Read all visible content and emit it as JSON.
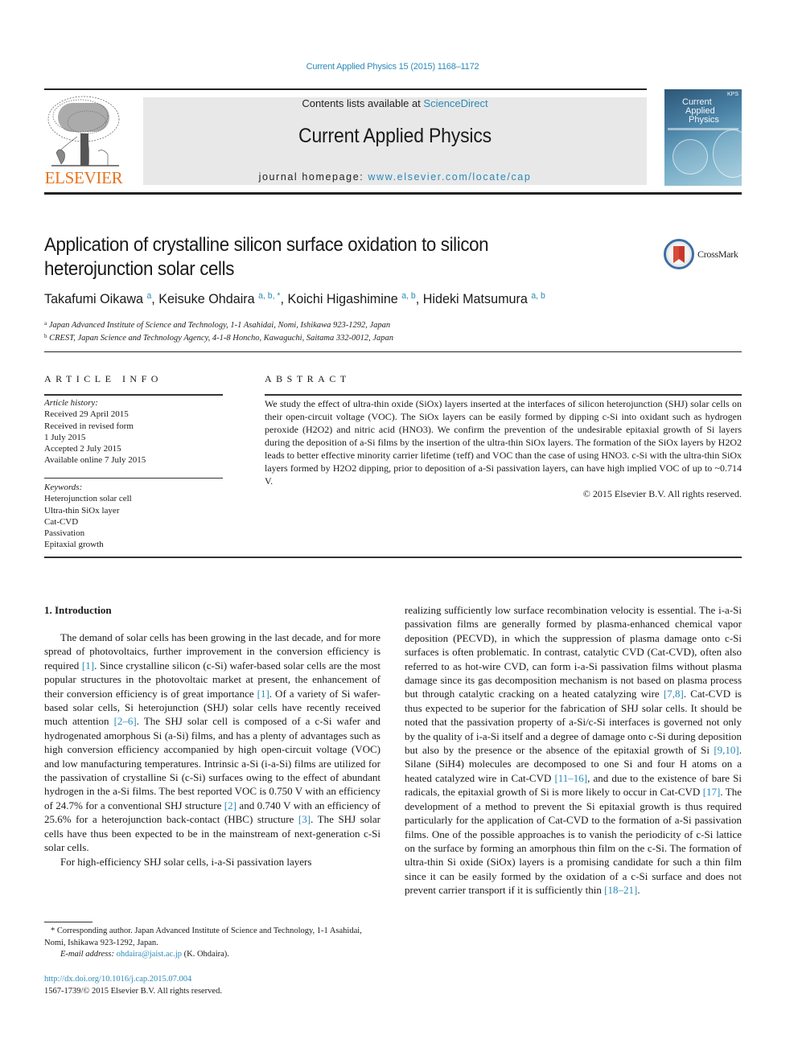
{
  "header": {
    "journal_ref": "Current Applied Physics 15 (2015) 1168–1172",
    "contents_prefix": "Contents lists available at ",
    "contents_link": "ScienceDirect",
    "journal_title": "Current Applied Physics",
    "homepage_prefix": "journal homepage: ",
    "homepage_link": "www.elsevier.com/locate/cap",
    "publisher_logo_text": "ELSEVIER",
    "cover": {
      "title_line1": "Current",
      "title_line2": "Applied",
      "title_line3": "Physics",
      "badge": "KPS"
    },
    "crossmark_label": "CrossMark",
    "colors": {
      "link": "#2a8ab8",
      "elsevier_orange": "#e7721f",
      "masthead_bg": "#e8e8e8"
    }
  },
  "article": {
    "title": "Application of crystalline silicon surface oxidation to silicon heterojunction solar cells",
    "authors": [
      {
        "name": "Takafumi Oikawa",
        "affil": "a",
        "sep": ", "
      },
      {
        "name": "Keisuke Ohdaira",
        "affil": "a, b, *",
        "sep": ", "
      },
      {
        "name": "Koichi Higashimine",
        "affil": "a, b",
        "sep": ", "
      },
      {
        "name": "Hideki Matsumura",
        "affil": "a, b",
        "sep": ""
      }
    ],
    "affiliations": [
      {
        "mark": "a",
        "text": "Japan Advanced Institute of Science and Technology, 1-1 Asahidai, Nomi, Ishikawa 923-1292, Japan"
      },
      {
        "mark": "b",
        "text": "CREST, Japan Science and Technology Agency, 4-1-8 Honcho, Kawaguchi, Saitama 332-0012, Japan"
      }
    ]
  },
  "article_info": {
    "heading": "ARTICLE INFO",
    "history_label": "Article history:",
    "history": [
      "Received 29 April 2015",
      "Received in revised form",
      "1 July 2015",
      "Accepted 2 July 2015",
      "Available online 7 July 2015"
    ],
    "keywords_label": "Keywords:",
    "keywords": [
      "Heterojunction solar cell",
      "Ultra-thin SiOx layer",
      "Cat-CVD",
      "Passivation",
      "Epitaxial growth"
    ]
  },
  "abstract": {
    "heading": "ABSTRACT",
    "text": "We study the effect of ultra-thin oxide (SiOx) layers inserted at the interfaces of silicon heterojunction (SHJ) solar cells on their open-circuit voltage (VOC). The SiOx layers can be easily formed by dipping c-Si into oxidant such as hydrogen peroxide (H2O2) and nitric acid (HNO3). We confirm the prevention of the undesirable epitaxial growth of Si layers during the deposition of a-Si films by the insertion of the ultra-thin SiOx layers. The formation of the SiOx layers by H2O2 leads to better effective minority carrier lifetime (τeff) and VOC than the case of using HNO3. c-Si with the ultra-thin SiOx layers formed by H2O2 dipping, prior to deposition of a-Si passivation layers, can have high implied VOC of up to ~0.714 V.",
    "copyright": "© 2015 Elsevier B.V. All rights reserved."
  },
  "body": {
    "section_heading": "1.  Introduction",
    "left_par1": "The demand of solar cells has been growing in the last decade, and for more spread of photovoltaics, further improvement in the conversion efficiency is required [1]. Since crystalline silicon (c-Si) wafer-based solar cells are the most popular structures in the photovoltaic market at present, the enhancement of their conversion efficiency is of great importance [1]. Of a variety of Si wafer-based solar cells, Si heterojunction (SHJ) solar cells have recently received much attention [2–6]. The SHJ solar cell is composed of a c-Si wafer and hydrogenated amorphous Si (a-Si) films, and has a plenty of advantages such as high conversion efficiency accompanied by high open-circuit voltage (VOC) and low manufacturing temperatures. Intrinsic a-Si (i-a-Si) films are utilized for the passivation of crystalline Si (c-Si) surfaces owing to the effect of abundant hydrogen in the a-Si films. The best reported VOC is 0.750 V with an efficiency of 24.7% for a conventional SHJ structure [2] and 0.740 V with an efficiency of 25.6% for a heterojunction back-contact (HBC) structure [3]. The SHJ solar cells have thus been expected to be in the mainstream of next-generation c-Si solar cells.",
    "left_par2_start": "For high-efficiency SHJ solar cells, i-a-Si passivation layers",
    "right_par": "realizing sufficiently low surface recombination velocity is essential. The i-a-Si passivation films are generally formed by plasma-enhanced chemical vapor deposition (PECVD), in which the suppression of plasma damage onto c-Si surfaces is often problematic. In contrast, catalytic CVD (Cat-CVD), often also referred to as hot-wire CVD, can form i-a-Si passivation films without plasma damage since its gas decomposition mechanism is not based on plasma process but through catalytic cracking on a heated catalyzing wire [7,8]. Cat-CVD is thus expected to be superior for the fabrication of SHJ solar cells. It should be noted that the passivation property of a-Si/c-Si interfaces is governed not only by the quality of i-a-Si itself and a degree of damage onto c-Si during deposition but also by the presence or the absence of the epitaxial growth of Si [9,10]. Silane (SiH4) molecules are decomposed to one Si and four H atoms on a heated catalyzed wire in Cat-CVD [11–16], and due to the existence of bare Si radicals, the epitaxial growth of Si is more likely to occur in Cat-CVD [17]. The development of a method to prevent the Si epitaxial growth is thus required particularly for the application of Cat-CVD to the formation of a-Si passivation films. One of the possible approaches is to vanish the periodicity of c-Si lattice on the surface by forming an amorphous thin film on the c-Si. The formation of ultra-thin Si oxide (SiOx) layers is a promising candidate for such a thin film since it can be easily formed by the oxidation of a c-Si surface and does not prevent carrier transport if it is sufficiently thin [18–21]."
  },
  "footnotes": {
    "corresponding": "* Corresponding author. Japan Advanced Institute of Science and Technology, 1-1 Asahidai, Nomi, Ishikawa 923-1292, Japan.",
    "email_label": "E-mail address:",
    "email": "ohdaira@jaist.ac.jp",
    "email_suffix": " (K. Ohdaira).",
    "doi": "http://dx.doi.org/10.1016/j.cap.2015.07.004",
    "issn_copyright": "1567-1739/© 2015 Elsevier B.V. All rights reserved."
  }
}
